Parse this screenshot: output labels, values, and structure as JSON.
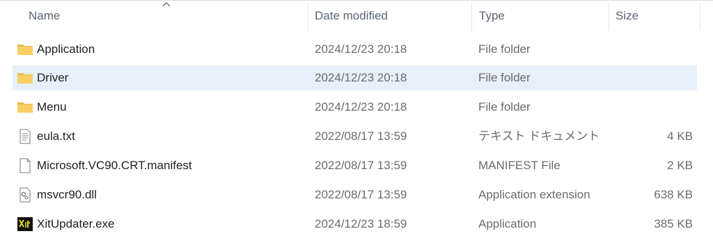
{
  "columns": {
    "name": "Name",
    "date": "Date modified",
    "type": "Type",
    "size": "Size"
  },
  "sort": {
    "column": "Name",
    "direction": "ascending",
    "icon": "sort-up-icon"
  },
  "colors": {
    "selected_row": "#e6f0fa",
    "folder": "#f2c45a",
    "header_text": "#5a6470"
  },
  "rows": [
    {
      "name": "Application",
      "date": "2024/12/23 20:18",
      "type": "File folder",
      "size": "",
      "icon": "folder-icon"
    },
    {
      "name": "Driver",
      "date": "2024/12/23 20:18",
      "type": "File folder",
      "size": "",
      "icon": "folder-icon",
      "selected": true
    },
    {
      "name": "Menu",
      "date": "2024/12/23 20:18",
      "type": "File folder",
      "size": "",
      "icon": "folder-icon"
    },
    {
      "name": "eula.txt",
      "date": "2022/08/17 13:59",
      "type": "テキスト ドキュメント",
      "size": "4 KB",
      "icon": "text-file-icon"
    },
    {
      "name": "Microsoft.VC90.CRT.manifest",
      "date": "2022/08/17 13:59",
      "type": "MANIFEST File",
      "size": "2 KB",
      "icon": "blank-file-icon"
    },
    {
      "name": "msvcr90.dll",
      "date": "2022/08/17 13:59",
      "type": "Application extension",
      "size": "638 KB",
      "icon": "dll-file-icon"
    },
    {
      "name": "XitUpdater.exe",
      "date": "2024/12/23 18:59",
      "type": "Application",
      "size": "385 KB",
      "icon": "xit-app-icon"
    }
  ]
}
